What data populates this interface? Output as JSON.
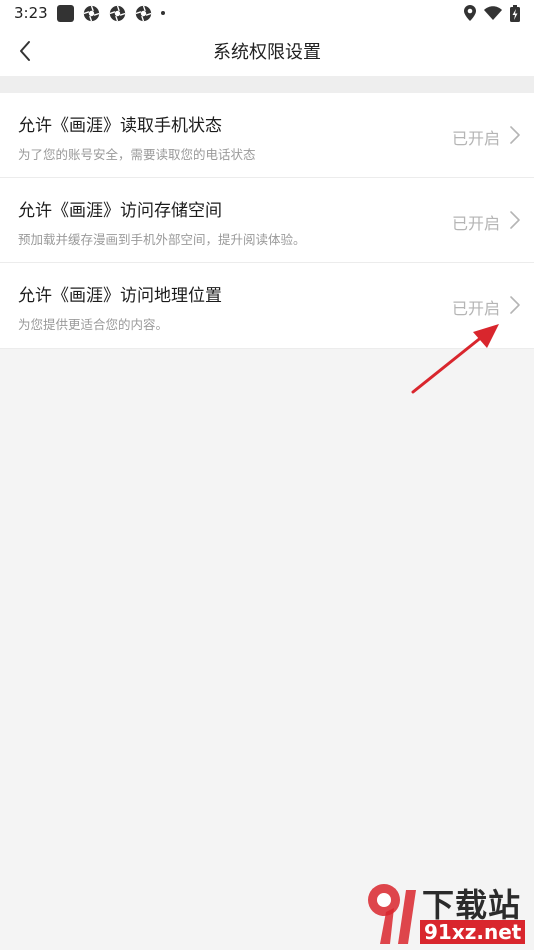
{
  "status_bar": {
    "time": "3:23"
  },
  "nav": {
    "title": "系统权限设置"
  },
  "permissions": [
    {
      "title": "允许《画涯》读取手机状态",
      "subtitle": "为了您的账号安全，需要读取您的电话状态",
      "status": "已开启"
    },
    {
      "title": "允许《画涯》访问存储空间",
      "subtitle": "预加载并缓存漫画到手机外部空间，提升阅读体验。",
      "status": "已开启"
    },
    {
      "title": "允许《画涯》访问地理位置",
      "subtitle": "为您提供更适合您的内容。",
      "status": "已开启"
    }
  ],
  "watermark": {
    "top_text": "下载站",
    "bottom_text": "91xz.net"
  },
  "colors": {
    "background": "#f4f4f4",
    "row_background": "#ffffff",
    "status_text": "#b5b5b5",
    "annotation_arrow": "#d9262d"
  },
  "icons": {
    "back": "chevron-left-icon",
    "row_arrow": "chevron-right-icon",
    "location": "location-pin-icon",
    "wifi": "wifi-icon",
    "battery": "battery-charging-icon"
  }
}
